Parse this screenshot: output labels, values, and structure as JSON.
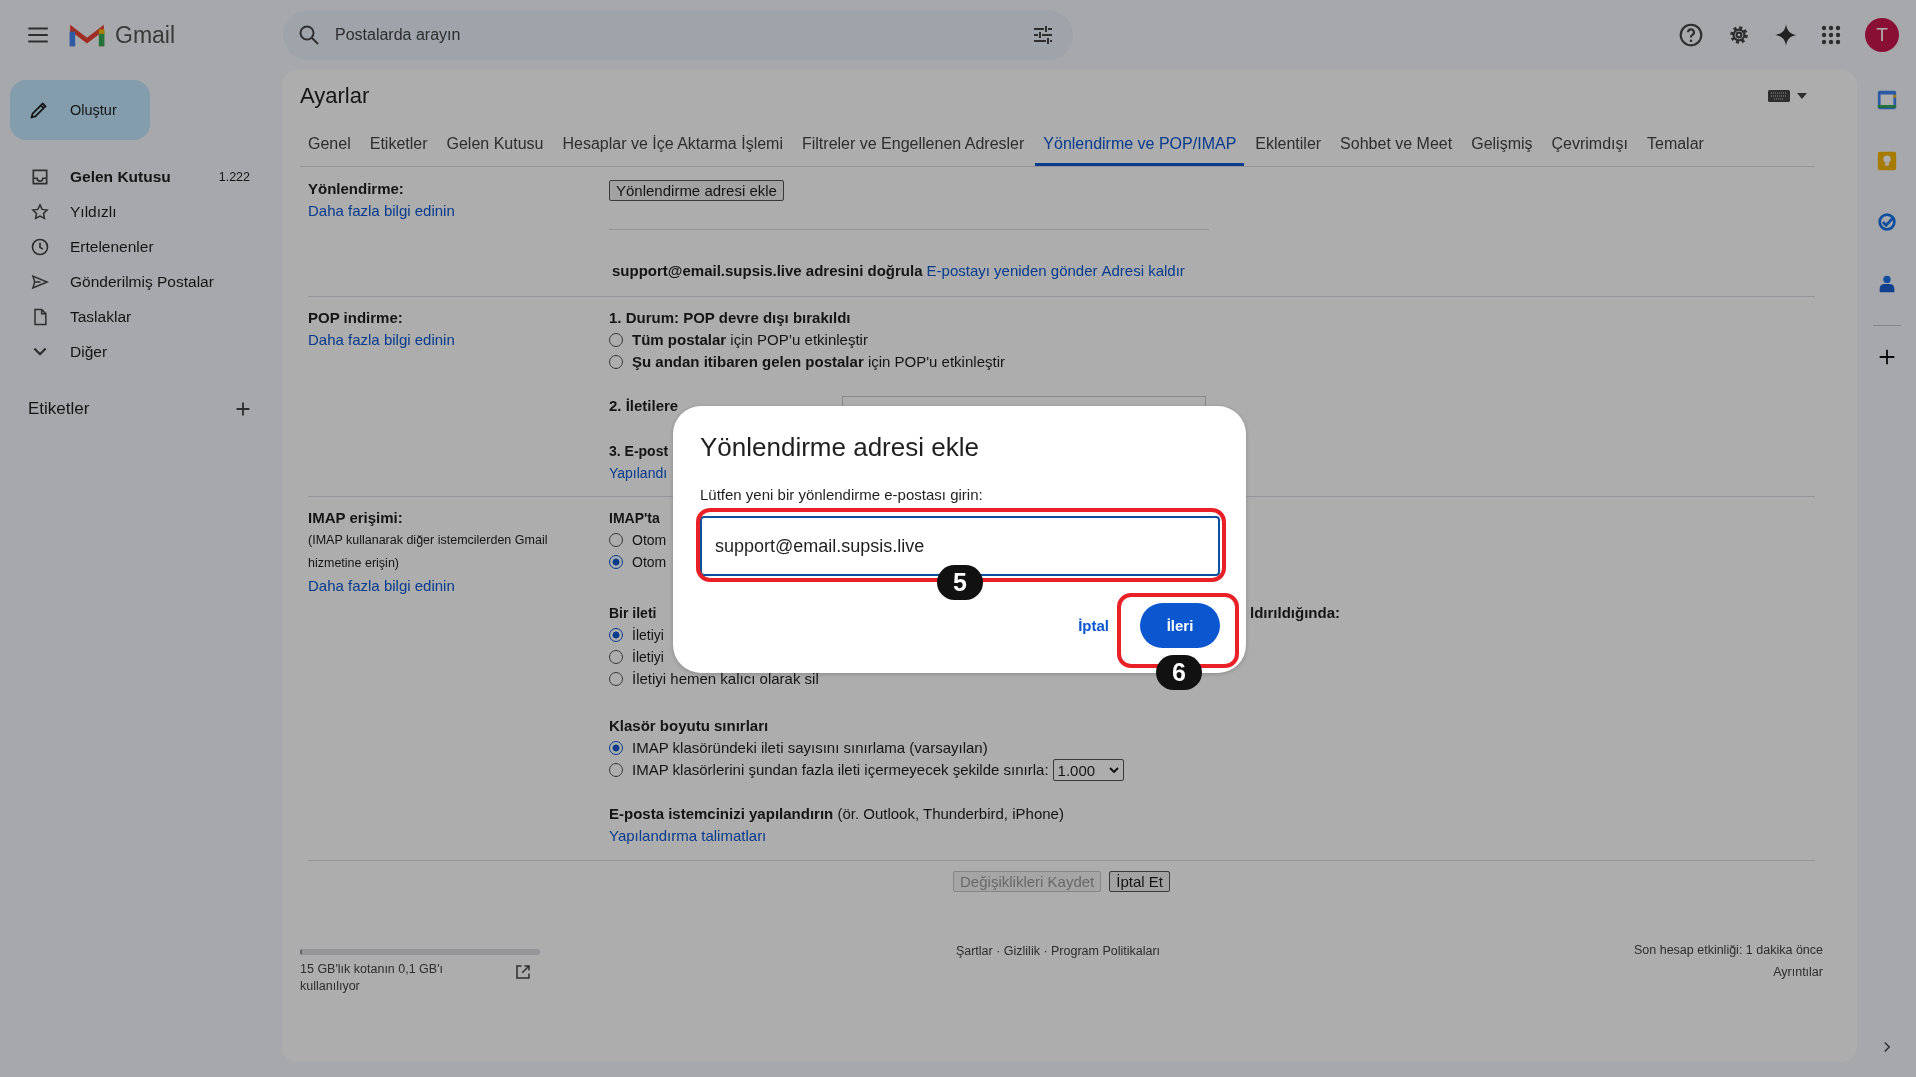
{
  "app": {
    "name": "Gmail"
  },
  "search": {
    "placeholder": "Postalarda arayın"
  },
  "account": {
    "initial": "T"
  },
  "compose": {
    "label": "Oluştur"
  },
  "nav": [
    {
      "label": "Gelen Kutusu",
      "count": "1.222",
      "unread": true,
      "selected": false
    },
    {
      "label": "Yıldızlı",
      "unread": false,
      "selected": false
    },
    {
      "label": "Ertelenenler",
      "unread": false,
      "selected": false
    },
    {
      "label": "Gönderilmiş Postalar",
      "unread": false,
      "selected": false
    },
    {
      "label": "Taslaklar",
      "unread": false,
      "selected": false
    },
    {
      "label": "Diğer",
      "unread": false,
      "selected": false
    }
  ],
  "labels_heading": "Etiketler",
  "settings": {
    "title": "Ayarlar",
    "tabs": [
      {
        "label": "Genel",
        "selected": false
      },
      {
        "label": "Etiketler",
        "selected": false
      },
      {
        "label": "Gelen Kutusu",
        "selected": false
      },
      {
        "label": "Hesaplar ve İçe Aktarma İşlemi",
        "selected": false
      },
      {
        "label": "Filtreler ve Engellenen Adresler",
        "selected": false
      },
      {
        "label": "Yönlendirme ve POP/IMAP",
        "selected": true
      },
      {
        "label": "Eklentiler",
        "selected": false
      },
      {
        "label": "Sohbet ve Meet",
        "selected": false
      },
      {
        "label": "Gelişmiş",
        "selected": false
      },
      {
        "label": "Çevrimdışı",
        "selected": false
      },
      {
        "label": "Temalar",
        "selected": false
      }
    ],
    "forwarding": {
      "label": "Yönlendirme:",
      "learn_more": "Daha fazla bilgi edinin",
      "add_button": "Yönlendirme adresi ekle",
      "verify_text": "support@email.supsis.live adresini doğrula",
      "links": [
        "E-postayı yeniden gönder",
        "Adresi kaldır"
      ]
    },
    "pop": {
      "label": "POP indirme:",
      "learn_more": "Daha fazla bilgi edinin",
      "status": "1. Durum: POP devre dışı bırakıldı",
      "options": [
        {
          "text": "**Tüm postalar** için POP’u etkinleştir",
          "selected": false
        },
        {
          "text": "**Şu andan itibaren gelen postalar** için POP'u etkinleştir",
          "selected": false
        }
      ],
      "step_2": "2. İletilere",
      "step_3": "3. E-post",
      "step_3_link": "Yapılandı"
    },
    "imap": {
      "label": "IMAP erişimi:",
      "description": "(IMAP kullanarak diğer istemcilerden Gmail hizmetine erişin)",
      "learn_more": "Daha fazla bilgi edinin",
      "status": "IMAP'ta",
      "access_options": [
        {
          "text": "Otom",
          "selected": false
        },
        {
          "text": "Otom",
          "selected": true
        }
      ],
      "delete_heading_start": "Bir ileti",
      "delete_heading_end": "ldırıldığında:",
      "delete_options": [
        {
          "text": "İletiyi",
          "selected": true
        },
        {
          "text": "İletiyi",
          "selected": false
        },
        {
          "text": "İletiyi hemen kalıcı olarak sil",
          "selected": false
        }
      ],
      "folder_heading": "Klasör boyutu sınırları",
      "folder_options": [
        {
          "text": "IMAP klasöründeki ileti sayısını sınırlama (varsayılan)",
          "selected": true
        },
        {
          "text": "IMAP klasörlerini şundan fazla ileti içermeyecek şekilde sınırla:",
          "selected": false
        }
      ],
      "folder_limit": "1.000",
      "client_text": "**E-posta istemcinizi yapılandırın** (ör. Outlook, Thunderbird, iPhone)",
      "client_link": "Yapılandırma talimatları"
    },
    "actions": [
      {
        "label": "Değişiklikleri Kaydet",
        "disabled": true
      },
      {
        "label": "İptal Et",
        "disabled": false
      }
    ]
  },
  "footer": {
    "storage": {
      "level": 0.01,
      "text": "15 GB'lık kotanın 0,1 GB'ı kullanılıyor"
    },
    "policies": "Şartlar · Gizlilik · Program Politikaları",
    "activity": "Son hesap etkinliği: 1 dakika önce",
    "details": "Ayrıntılar"
  },
  "dialog": {
    "title": "Yönlendirme adresi ekle",
    "prompt": "Lütfen yeni bir yönlendirme e-postası girin:",
    "value": "support@email.supsis.live",
    "cancel": "İptal",
    "next": "İleri"
  },
  "annotations": [
    {
      "label": "5"
    },
    {
      "label": "6"
    }
  ]
}
